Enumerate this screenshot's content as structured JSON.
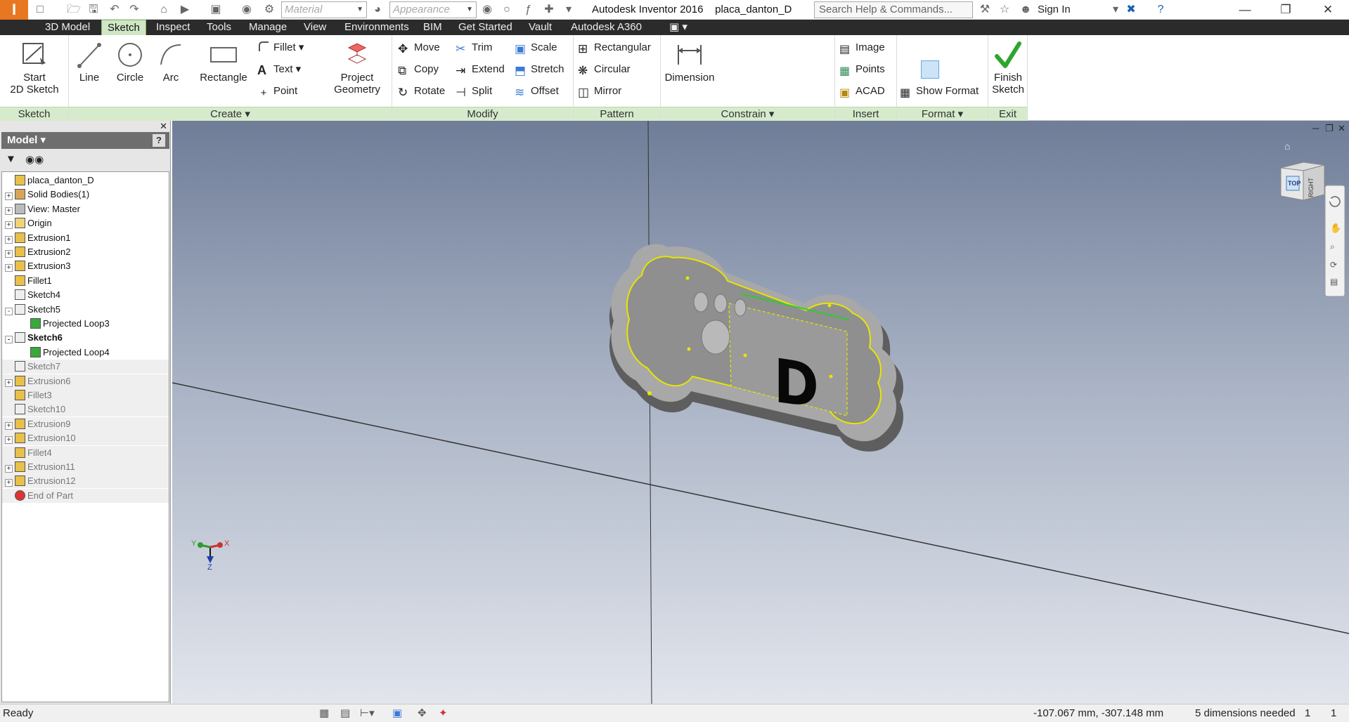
{
  "titlebar": {
    "material_placeholder": "Material",
    "appearance_placeholder": "Appearance",
    "app_title": "Autodesk Inventor 2016",
    "doc_title": "placa_danton_D",
    "search_placeholder": "Search Help & Commands...",
    "sign_in": "Sign In"
  },
  "tabs": [
    "3D Model",
    "Sketch",
    "Inspect",
    "Tools",
    "Manage",
    "View",
    "Environments",
    "BIM",
    "Get Started",
    "Vault",
    "Autodesk A360"
  ],
  "active_tab": "Sketch",
  "ribbon": {
    "sketch": {
      "title": "Sketch",
      "start": "Start",
      "start2": "2D Sketch"
    },
    "create": {
      "title": "Create",
      "line": "Line",
      "circle": "Circle",
      "arc": "Arc",
      "rectangle": "Rectangle",
      "fillet": "Fillet",
      "text": "Text",
      "point": "Point",
      "project": "Project",
      "geometry": "Geometry"
    },
    "modify": {
      "title": "Modify",
      "move": "Move",
      "copy": "Copy",
      "rotate": "Rotate",
      "trim": "Trim",
      "extend": "Extend",
      "split": "Split",
      "scale": "Scale",
      "stretch": "Stretch",
      "offset": "Offset"
    },
    "pattern": {
      "title": "Pattern",
      "rectangular": "Rectangular",
      "circular": "Circular",
      "mirror": "Mirror"
    },
    "constrain": {
      "title": "Constrain",
      "dimension": "Dimension"
    },
    "insert": {
      "title": "Insert",
      "image": "Image",
      "points": "Points",
      "acad": "ACAD"
    },
    "format": {
      "title": "Format",
      "show_format": "Show Format"
    },
    "exit": {
      "title": "Exit",
      "finish": "Finish",
      "finish2": "Sketch"
    }
  },
  "browser": {
    "header": "Model",
    "items": [
      {
        "label": "placa_danton_D",
        "icon": "part-icon",
        "expand": "",
        "dim": false,
        "bold": false,
        "indent": 0
      },
      {
        "label": "Solid Bodies(1)",
        "icon": "solid-bodies-icon",
        "expand": "+",
        "dim": false,
        "bold": false,
        "indent": 1
      },
      {
        "label": "View: Master",
        "icon": "view-icon",
        "expand": "+",
        "dim": false,
        "bold": false,
        "indent": 1
      },
      {
        "label": "Origin",
        "icon": "folder-icon",
        "expand": "+",
        "dim": false,
        "bold": false,
        "indent": 1
      },
      {
        "label": "Extrusion1",
        "icon": "extrusion-icon",
        "expand": "+",
        "dim": false,
        "bold": false,
        "indent": 1
      },
      {
        "label": "Extrusion2",
        "icon": "extrusion-icon",
        "expand": "+",
        "dim": false,
        "bold": false,
        "indent": 1
      },
      {
        "label": "Extrusion3",
        "icon": "extrusion-icon",
        "expand": "+",
        "dim": false,
        "bold": false,
        "indent": 1
      },
      {
        "label": "Fillet1",
        "icon": "fillet-icon",
        "expand": "",
        "dim": false,
        "bold": false,
        "indent": 1
      },
      {
        "label": "Sketch4",
        "icon": "sketch-icon",
        "expand": "",
        "dim": false,
        "bold": false,
        "indent": 1
      },
      {
        "label": "Sketch5",
        "icon": "sketch-icon",
        "expand": "-",
        "dim": false,
        "bold": false,
        "indent": 1
      },
      {
        "label": "Projected Loop3",
        "icon": "projected-loop-icon",
        "expand": "",
        "dim": false,
        "bold": false,
        "indent": 2
      },
      {
        "label": "Sketch6",
        "icon": "sketch-icon",
        "expand": "-",
        "dim": false,
        "bold": true,
        "indent": 1
      },
      {
        "label": "Projected Loop4",
        "icon": "projected-loop-icon",
        "expand": "",
        "dim": false,
        "bold": false,
        "indent": 2
      },
      {
        "label": "Sketch7",
        "icon": "sketch-icon",
        "expand": "",
        "dim": true,
        "bold": false,
        "indent": 1
      },
      {
        "label": "Extrusion6",
        "icon": "extrusion-icon",
        "expand": "+",
        "dim": true,
        "bold": false,
        "indent": 1
      },
      {
        "label": "Fillet3",
        "icon": "fillet-icon",
        "expand": "",
        "dim": true,
        "bold": false,
        "indent": 1
      },
      {
        "label": "Sketch10",
        "icon": "sketch-icon",
        "expand": "",
        "dim": true,
        "bold": false,
        "indent": 1
      },
      {
        "label": "Extrusion9",
        "icon": "extrusion-icon",
        "expand": "+",
        "dim": true,
        "bold": false,
        "indent": 1
      },
      {
        "label": "Extrusion10",
        "icon": "extrusion-icon",
        "expand": "+",
        "dim": true,
        "bold": false,
        "indent": 1
      },
      {
        "label": "Fillet4",
        "icon": "fillet-icon",
        "expand": "",
        "dim": true,
        "bold": false,
        "indent": 1
      },
      {
        "label": "Extrusion11",
        "icon": "extrusion-icon",
        "expand": "+",
        "dim": true,
        "bold": false,
        "indent": 1
      },
      {
        "label": "Extrusion12",
        "icon": "extrusion-icon",
        "expand": "+",
        "dim": true,
        "bold": false,
        "indent": 1
      },
      {
        "label": "End of Part",
        "icon": "end-of-part-icon",
        "expand": "",
        "dim": true,
        "bold": false,
        "indent": 1
      }
    ]
  },
  "viewport": {
    "viewcube_top": "TOP",
    "viewcube_right": "RIGHT",
    "letter": "D",
    "axis_x": "X",
    "axis_y": "Y",
    "axis_z": "Z"
  },
  "status": {
    "text": "Ready",
    "coords": "-107.067 mm, -307.148 mm",
    "dimensions": "5 dimensions needed",
    "count1": "1",
    "count2": "1"
  },
  "colors": {
    "ribbon_panel_title": "#d6ebcc",
    "tab_bar": "#2b2b2b",
    "sketch_highlight": "#e6e600",
    "constraint_green": "#2ecc2e"
  }
}
